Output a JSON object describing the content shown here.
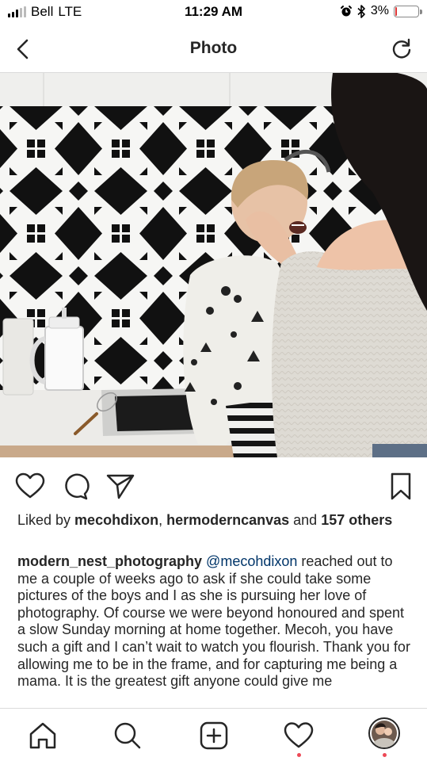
{
  "status_bar": {
    "carrier": "Bell",
    "network": "LTE",
    "time": "11:29 AM",
    "battery_percent": "3%",
    "battery_level": 0.03,
    "icons": [
      "signal-icon",
      "alarm-icon",
      "bluetooth-icon",
      "battery-icon"
    ]
  },
  "nav": {
    "title": "Photo",
    "back_icon": "chevron-left-icon",
    "refresh_icon": "refresh-icon"
  },
  "actions": {
    "icons": [
      "heart-icon",
      "comment-icon",
      "share-icon",
      "bookmark-icon"
    ]
  },
  "likes": {
    "prefix": "Liked by ",
    "user1": "mecohdixon",
    "separator": ", ",
    "user2": "hermoderncanvas",
    "and_text": " and ",
    "others": "157 others"
  },
  "caption": {
    "username": "modern_nest_photography",
    "mention": "@mecohdixon",
    "text": " reached out to me a couple of weeks ago to ask if she could take some pictures of the boys and I as she is pursuing her love of photography. Of course we were beyond honoured and spent a slow Sunday morning at home together. Mecoh, you have such a gift and I can’t wait to watch you flourish. Thank you for allowing me to be in the frame, and for capturing me being a mama. It is the greatest gift anyone could give me"
  },
  "tabbar": {
    "icons": [
      "home-icon",
      "search-icon",
      "add-post-icon",
      "activity-heart-icon",
      "profile-avatar"
    ],
    "colors": {
      "notification_dot": "#ed4956"
    }
  }
}
